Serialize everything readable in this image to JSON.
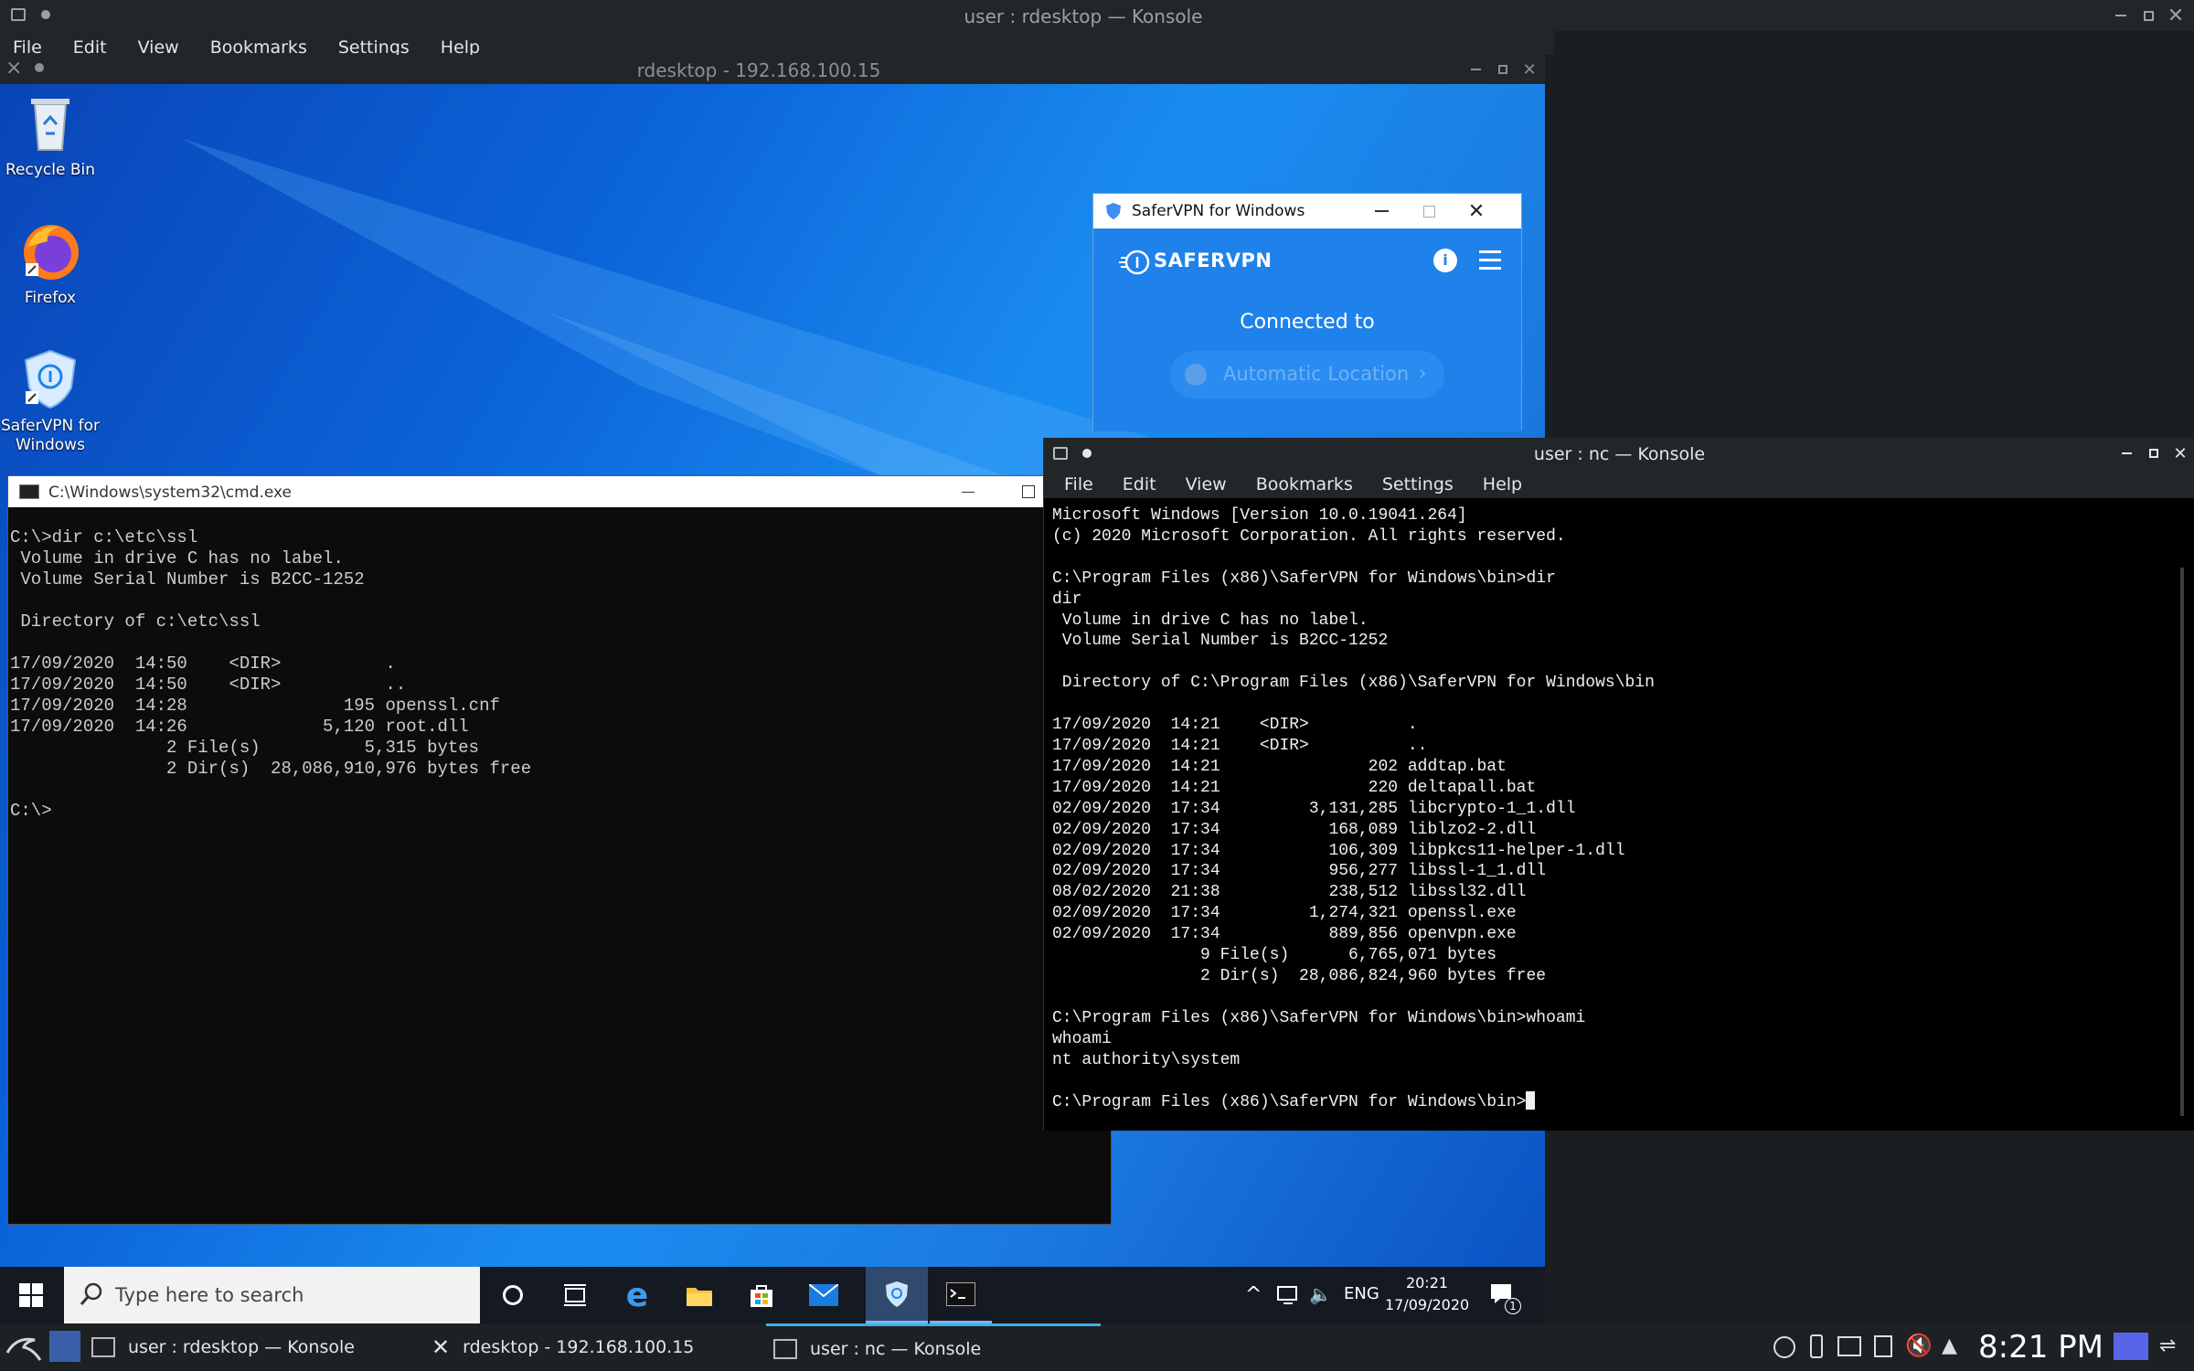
{
  "outer_konsole": {
    "title": "user : rdesktop — Konsole",
    "menu": [
      "File",
      "Edit",
      "View",
      "Bookmarks",
      "Settings",
      "Help"
    ]
  },
  "rdesktop": {
    "title": "rdesktop - 192.168.100.15"
  },
  "desktop_icons": [
    {
      "label": "Recycle Bin",
      "icon": "recycle-bin-icon"
    },
    {
      "label": "Firefox",
      "icon": "firefox-icon"
    },
    {
      "label": "SaferVPN for Windows",
      "icon": "safervpn-icon"
    }
  ],
  "vpn_window": {
    "title": "SaferVPN for Windows",
    "brand": "SAFERVPN",
    "status": "Connected to",
    "location": "Automatic Location",
    "colors": {
      "accent": "#1f82ea"
    }
  },
  "cmd_window": {
    "title": "C:\\Windows\\system32\\cmd.exe",
    "lines": [
      "C:\\>dir c:\\etc\\ssl",
      " Volume in drive C has no label.",
      " Volume Serial Number is B2CC-1252",
      "",
      " Directory of c:\\etc\\ssl",
      "",
      "17/09/2020  14:50    <DIR>          .",
      "17/09/2020  14:50    <DIR>          ..",
      "17/09/2020  14:28               195 openssl.cnf",
      "17/09/2020  14:26             5,120 root.dll",
      "               2 File(s)          5,315 bytes",
      "               2 Dir(s)  28,086,910,976 bytes free",
      "",
      "C:\\>"
    ]
  },
  "win_taskbar": {
    "search_placeholder": "Type here to search",
    "tray_lang": "ENG",
    "clock_time": "20:21",
    "clock_date": "17/09/2020",
    "notification_count": "1"
  },
  "nc_konsole": {
    "title": "user : nc — Konsole",
    "menu": [
      "File",
      "Edit",
      "View",
      "Bookmarks",
      "Settings",
      "Help"
    ],
    "lines": [
      "Microsoft Windows [Version 10.0.19041.264]",
      "(c) 2020 Microsoft Corporation. All rights reserved.",
      "",
      "C:\\Program Files (x86)\\SaferVPN for Windows\\bin>dir",
      "dir",
      " Volume in drive C has no label.",
      " Volume Serial Number is B2CC-1252",
      "",
      " Directory of C:\\Program Files (x86)\\SaferVPN for Windows\\bin",
      "",
      "17/09/2020  14:21    <DIR>          .",
      "17/09/2020  14:21    <DIR>          ..",
      "17/09/2020  14:21               202 addtap.bat",
      "17/09/2020  14:21               220 deltapall.bat",
      "02/09/2020  17:34         3,131,285 libcrypto-1_1.dll",
      "02/09/2020  17:34           168,089 liblzo2-2.dll",
      "02/09/2020  17:34           106,309 libpkcs11-helper-1.dll",
      "02/09/2020  17:34           956,277 libssl-1_1.dll",
      "08/02/2020  21:38           238,512 libssl32.dll",
      "02/09/2020  17:34         1,274,321 openssl.exe",
      "02/09/2020  17:34           889,856 openvpn.exe",
      "               9 File(s)      6,765,071 bytes",
      "               2 Dir(s)  28,086,824,960 bytes free",
      "",
      "C:\\Program Files (x86)\\SaferVPN for Windows\\bin>whoami",
      "whoami",
      "nt authority\\system",
      ""
    ],
    "prompt": "C:\\Program Files (x86)\\SaferVPN for Windows\\bin>"
  },
  "kde_panel": {
    "tasks": [
      "user : rdesktop — Konsole",
      "rdesktop - 192.168.100.15",
      "user : nc — Konsole"
    ],
    "clock": "8:21 PM"
  }
}
